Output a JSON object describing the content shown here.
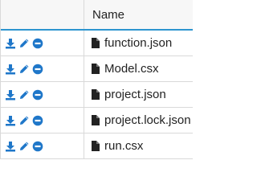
{
  "table": {
    "header": {
      "name_label": "Name"
    },
    "rows": [
      {
        "name": "function.json"
      },
      {
        "name": "Model.csx"
      },
      {
        "name": "project.json"
      },
      {
        "name": "project.lock.json"
      },
      {
        "name": "run.csx"
      }
    ],
    "icons": {
      "download": "download-icon",
      "edit": "pencil-icon",
      "delete": "minus-circle-icon",
      "file": "file-icon"
    },
    "colors": {
      "accent": "#2d95cf",
      "icon_blue": "#1f77c9",
      "header_bg": "#f7f7f7",
      "border": "#d9d9d9"
    }
  }
}
